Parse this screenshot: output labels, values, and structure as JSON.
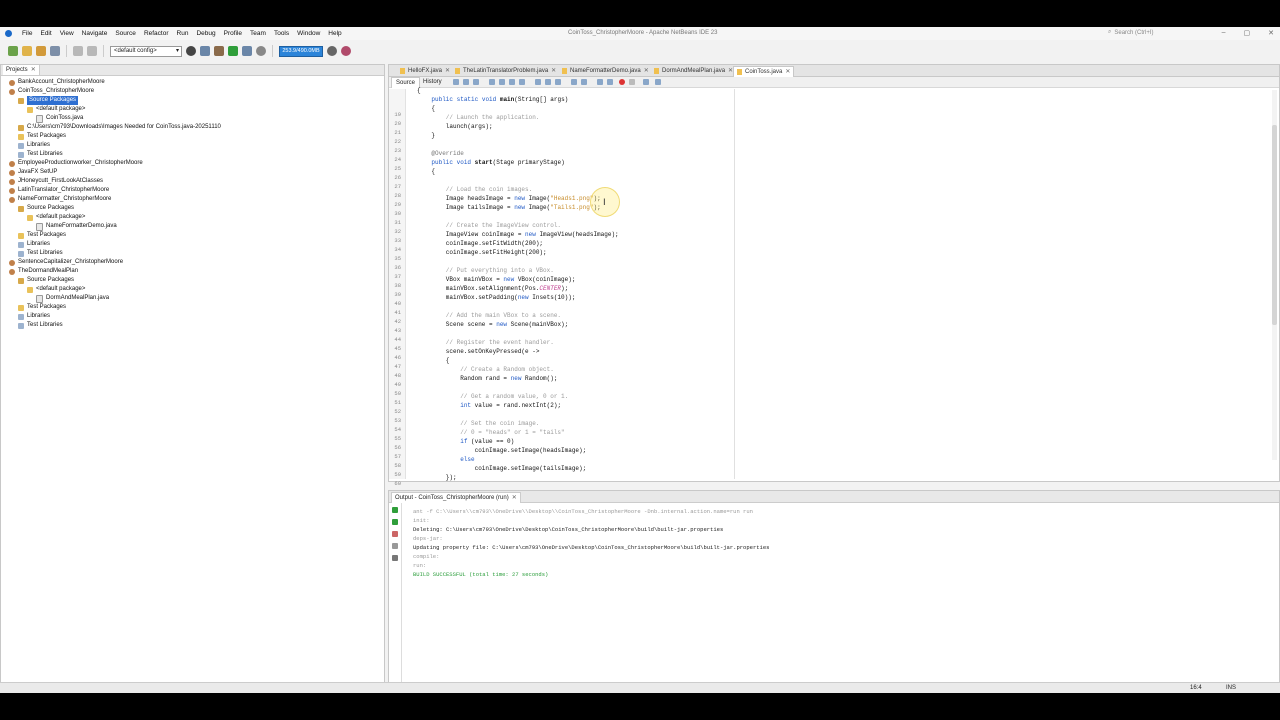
{
  "window": {
    "title": "CoinToss_ChristopherMoore - Apache NetBeans IDE 23"
  },
  "menu": [
    "File",
    "Edit",
    "View",
    "Navigate",
    "Source",
    "Refactor",
    "Run",
    "Debug",
    "Profile",
    "Team",
    "Tools",
    "Window",
    "Help"
  ],
  "search": {
    "placeholder": "Search (Ctrl+I)"
  },
  "toolbar": {
    "config": "<default config>",
    "memory": "253.9/490.0MB"
  },
  "projects": {
    "tab_label": "Projects",
    "rows": [
      "BankAccount_ChristopherMoore",
      "CoinToss_ChristopherMoore",
      "Source Packages",
      "<default package>",
      "CoinToss.java",
      "C:\\Users\\cm793\\Downloads\\Images Needed for CoinToss.java-20251110",
      "Test Packages",
      "Libraries",
      "Test Libraries",
      "EmployeeProductionworker_ChristopherMoore",
      "JavaFX SetUP",
      "JHoneycutt_FirstLookAtClasses",
      "LatinTranslator_ChristopherMoore",
      "NameFormatter_ChristopherMoore",
      "Source Packages",
      "<default package>",
      "NameFormatterDemo.java",
      "Test Packages",
      "Libraries",
      "Test Libraries",
      "SentenceCapitalizer_ChristopherMoore",
      "TheDormandMealPlan",
      "Source Packages",
      "<default package>",
      "DormAndMealPlan.java",
      "Test Packages",
      "Libraries",
      "Test Libraries"
    ]
  },
  "editor": {
    "tabs": [
      "HelloFX.java",
      "TheLatinTranslatorProblem.java",
      "NameFormatterDemo.java",
      "DormAndMealPlan.java",
      "CoinToss.java"
    ],
    "view_tabs": [
      "Source",
      "History"
    ],
    "line_numbers": [
      "19",
      "20",
      "21",
      "22",
      "23",
      "24",
      "25",
      "26",
      "27",
      "28",
      "29",
      "30",
      "31",
      "32",
      "33",
      "34",
      "35",
      "36",
      "37",
      "38",
      "39",
      "40",
      "41",
      "42",
      "43",
      "44",
      "45",
      "46",
      "47",
      "48",
      "49",
      "50",
      "51",
      "52",
      "53",
      "54",
      "55",
      "56",
      "57",
      "58",
      "59",
      "60",
      "61",
      "62"
    ],
    "lines": [
      "{",
      "    public static void main(String[] args)",
      "    {",
      "        // Launch the application.",
      "        launch(args);",
      "    }",
      "",
      "    @Override",
      "    public void start(Stage primaryStage)",
      "    {",
      "",
      "        // Load the coin images.",
      "        Image headsImage = new Image(\"Heads1.png\");",
      "        Image tailsImage = new Image(\"Tails1.png\");",
      "",
      "        // Create the ImageView control.",
      "        ImageView coinImage = new ImageView(headsImage);",
      "        coinImage.setFitWidth(200);",
      "        coinImage.setFitHeight(200);",
      "",
      "        // Put everything into a VBox.",
      "        VBox mainVBox = new VBox(coinImage);",
      "        mainVBox.setAlignment(Pos.CENTER);",
      "        mainVBox.setPadding(new Insets(10));",
      "",
      "        // Add the main VBox to a scene.",
      "        Scene scene = new Scene(mainVBox);",
      "",
      "        // Register the event handler.",
      "        scene.setOnKeyPressed(e ->",
      "        {",
      "            // Create a Random object.",
      "            Random rand = new Random();",
      "",
      "            // Get a random value, 0 or 1.",
      "            int value = rand.nextInt(2);",
      "",
      "            // Set the coin image.",
      "            // 0 = \"heads\" or 1 = \"tails\"",
      "            if (value == 0)",
      "                coinImage.setImage(headsImage);",
      "            else",
      "                coinImage.setImage(tailsImage);",
      "        });"
    ]
  },
  "output": {
    "tab_label": "Output - CoinToss_ChristopherMoore (run)",
    "lines": [
      "ant -f C:\\\\Users\\\\cm793\\\\OneDrive\\\\Desktop\\\\CoinToss_ChristopherMoore -Dnb.internal.action.name=run run",
      "init:",
      "Deleting: C:\\Users\\cm793\\OneDrive\\Desktop\\CoinToss_ChristopherMoore\\build\\built-jar.properties",
      "deps-jar:",
      "Updating property file: C:\\Users\\cm793\\OneDrive\\Desktop\\CoinToss_ChristopherMoore\\build\\built-jar.properties",
      "compile:",
      "run:",
      "BUILD SUCCESSFUL (total time: 27 seconds)"
    ]
  },
  "status": {
    "position": "16:4",
    "mode": "INS"
  },
  "colors": {
    "accent": "#2e6fd1",
    "keyword": "#1d57c4",
    "string": "#c78c2a",
    "comment": "#9a9a9a",
    "success": "#2a9d3a"
  }
}
